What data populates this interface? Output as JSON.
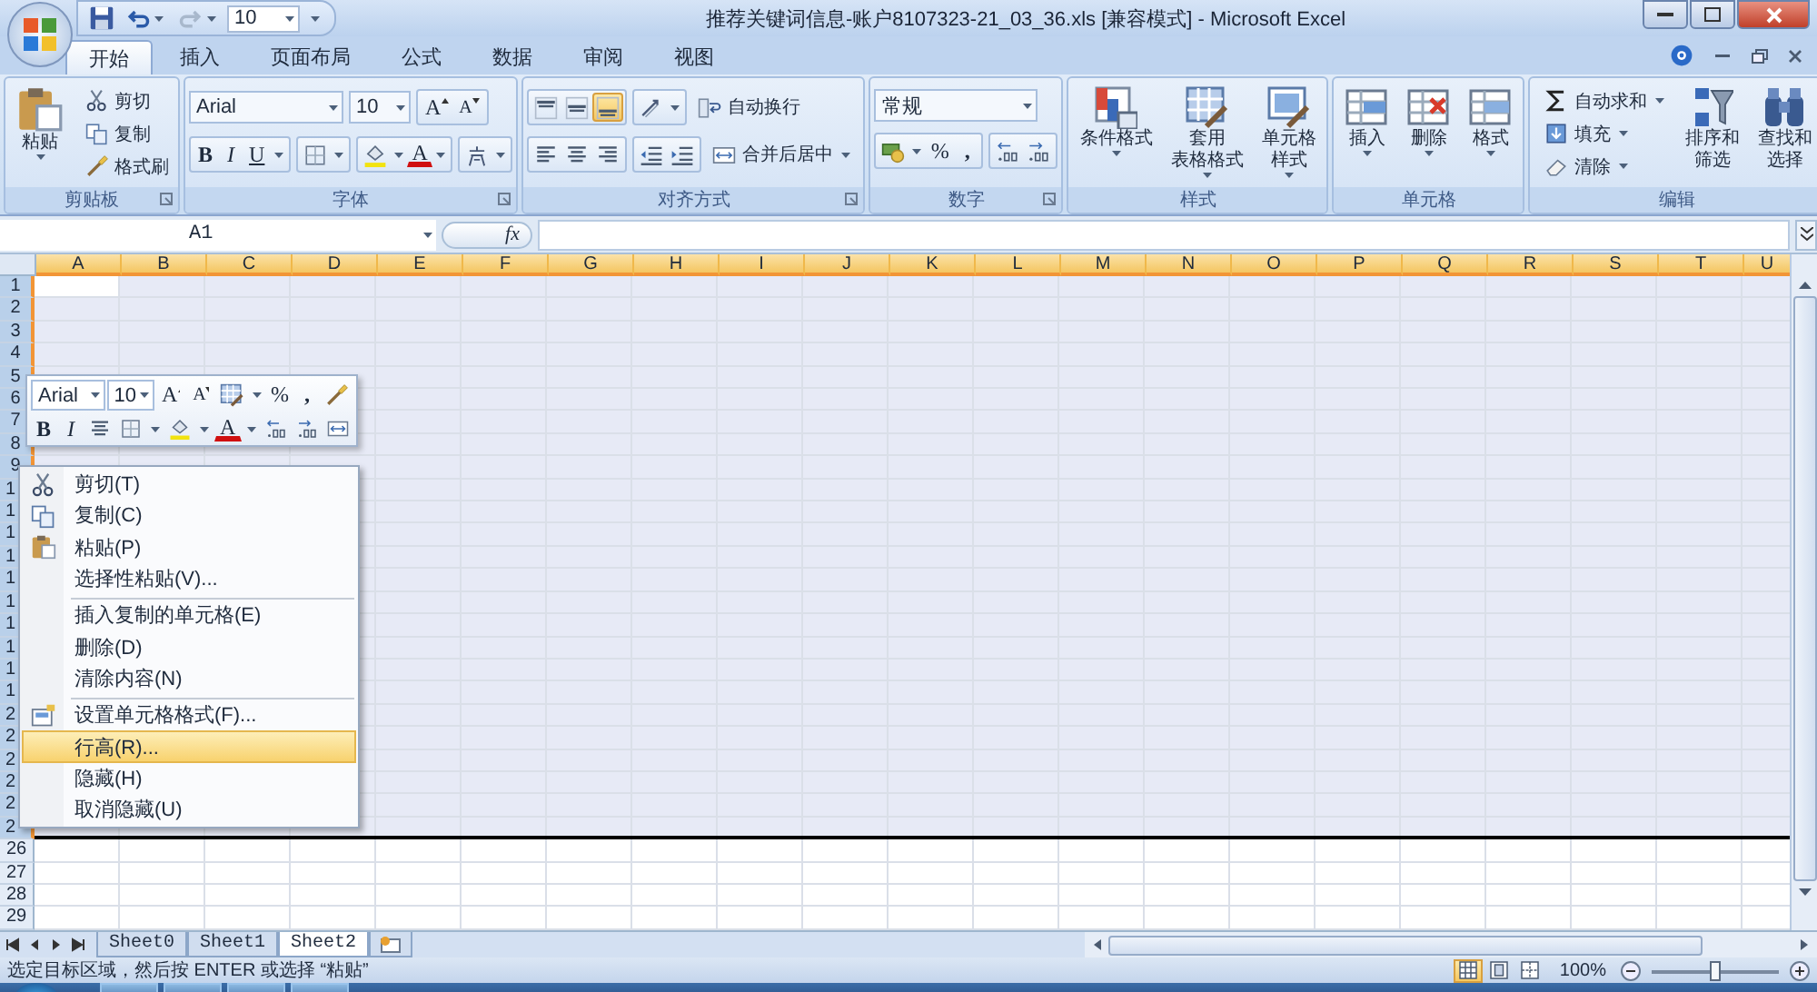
{
  "title_bar": {
    "font_size": "10",
    "title": "推荐关键词信息-账户8107323-21_03_36.xls  [兼容模式] - Microsoft Excel"
  },
  "tabs": [
    {
      "label": "开始",
      "selected": true
    },
    {
      "label": "插入",
      "selected": false
    },
    {
      "label": "页面布局",
      "selected": false
    },
    {
      "label": "公式",
      "selected": false
    },
    {
      "label": "数据",
      "selected": false
    },
    {
      "label": "审阅",
      "selected": false
    },
    {
      "label": "视图",
      "selected": false
    }
  ],
  "ribbon": {
    "clipboard": {
      "label": "剪贴板",
      "launcher": true,
      "paste": "粘贴",
      "items": [
        {
          "kind": "cut",
          "label": "剪切"
        },
        {
          "kind": "copy",
          "label": "复制"
        },
        {
          "kind": "brush",
          "label": "格式刷"
        }
      ]
    },
    "font": {
      "label": "字体",
      "launcher": true,
      "font_name": "Arial",
      "font_size": "10",
      "grow": "A",
      "shrink": "A",
      "bold": "B",
      "italic": "I",
      "underline": "U",
      "font_color": "A"
    },
    "alignment": {
      "label": "对齐方式",
      "launcher": true,
      "vertical": [
        {
          "selected": false
        },
        {
          "selected": false
        },
        {
          "selected": true
        }
      ],
      "horizontal": [
        {
          "selected": false
        },
        {
          "selected": false
        },
        {
          "selected": false
        }
      ],
      "wrap": "自动换行",
      "merge": "合并后居中"
    },
    "number": {
      "label": "数字",
      "launcher": true,
      "format": "常规",
      "percent": "%",
      "comma": ","
    },
    "styles": {
      "label": "样式",
      "buttons": [
        {
          "kind": "cond",
          "lines": [
            "条件格式"
          ]
        },
        {
          "kind": "table",
          "lines": [
            "套用",
            "表格格式"
          ]
        },
        {
          "kind": "cellstyle",
          "lines": [
            "单元格",
            "样式"
          ]
        }
      ]
    },
    "cells": {
      "label": "单元格",
      "buttons": [
        {
          "kind": "insert",
          "label": "插入"
        },
        {
          "kind": "delete",
          "label": "删除"
        },
        {
          "kind": "format",
          "label": "格式"
        }
      ]
    },
    "editing": {
      "label": "编辑",
      "small": [
        {
          "kind": "sum",
          "label": "自动求和"
        },
        {
          "kind": "filldown",
          "label": "填充"
        },
        {
          "kind": "eraser",
          "label": "清除"
        }
      ],
      "big": [
        {
          "kind": "sort",
          "lines": [
            "排序和",
            "筛选"
          ]
        },
        {
          "kind": "find",
          "lines": [
            "查找和",
            "选择"
          ]
        }
      ]
    }
  },
  "formula_bar": {
    "name_box": "A1",
    "function_button": "fx"
  },
  "columns": [
    {
      "label": "A",
      "selected": true
    },
    {
      "label": "B",
      "selected": true
    },
    {
      "label": "C",
      "selected": true
    },
    {
      "label": "D",
      "selected": true
    },
    {
      "label": "E",
      "selected": true
    },
    {
      "label": "F",
      "selected": true
    },
    {
      "label": "G",
      "selected": true
    },
    {
      "label": "H",
      "selected": true
    },
    {
      "label": "I",
      "selected": true
    },
    {
      "label": "J",
      "selected": true
    },
    {
      "label": "K",
      "selected": true
    },
    {
      "label": "L",
      "selected": true
    },
    {
      "label": "M",
      "selected": true
    },
    {
      "label": "N",
      "selected": true
    },
    {
      "label": "O",
      "selected": true
    },
    {
      "label": "P",
      "selected": true
    },
    {
      "label": "Q",
      "selected": true
    },
    {
      "label": "R",
      "selected": true
    },
    {
      "label": "S",
      "selected": true
    },
    {
      "label": "T",
      "selected": true
    },
    {
      "label": "U",
      "selected": true
    }
  ],
  "rows": [
    {
      "label": "1",
      "selected": true,
      "active": true
    },
    {
      "label": "2",
      "selected": true,
      "active": false
    },
    {
      "label": "3",
      "selected": true,
      "active": false
    },
    {
      "label": "4",
      "selected": true,
      "active": false
    },
    {
      "label": "5",
      "selected": true,
      "active": false
    },
    {
      "label": "6",
      "selected": true,
      "active": false
    },
    {
      "label": "7",
      "selected": true,
      "active": false
    },
    {
      "label": "8",
      "selected": true,
      "active": false
    },
    {
      "label": "9",
      "selected": true,
      "active": false
    },
    {
      "label": "1",
      "selected": true,
      "active": false
    },
    {
      "label": "1",
      "selected": true,
      "active": false
    },
    {
      "label": "1",
      "selected": true,
      "active": false
    },
    {
      "label": "1",
      "selected": true,
      "active": false
    },
    {
      "label": "1",
      "selected": true,
      "active": false
    },
    {
      "label": "1",
      "selected": true,
      "active": false
    },
    {
      "label": "1",
      "selected": true,
      "active": false
    },
    {
      "label": "1",
      "selected": true,
      "active": false
    },
    {
      "label": "1",
      "selected": true,
      "active": false
    },
    {
      "label": "1",
      "selected": true,
      "active": false
    },
    {
      "label": "2",
      "selected": true,
      "active": false
    },
    {
      "label": "2",
      "selected": true,
      "active": false
    },
    {
      "label": "2",
      "selected": true,
      "active": false
    },
    {
      "label": "2",
      "selected": true,
      "active": false
    },
    {
      "label": "2",
      "selected": true,
      "active": false
    },
    {
      "label": "2",
      "selected": true,
      "active": false
    },
    {
      "label": "26",
      "selected": false
    },
    {
      "label": "27",
      "selected": false
    },
    {
      "label": "28",
      "selected": false
    },
    {
      "label": "29",
      "selected": false
    }
  ],
  "mini_toolbar": {
    "font_name": "Arial",
    "font_size": "10",
    "grow": "A",
    "shrink": "A",
    "percent": "%",
    "comma": ",",
    "bold": "B",
    "italic": "I",
    "font_color": "A"
  },
  "context_menu": [
    {
      "label": "剪切(T)",
      "kind": "cut",
      "separator_before": false,
      "selected": false
    },
    {
      "label": "复制(C)",
      "kind": "copy",
      "separator_before": false,
      "selected": false
    },
    {
      "label": "粘贴(P)",
      "kind": "paste",
      "separator_before": false,
      "selected": false
    },
    {
      "label": "选择性粘贴(V)...",
      "separator_before": false,
      "selected": false
    },
    {
      "label": "插入复制的单元格(E)",
      "separator_before": true,
      "selected": false
    },
    {
      "label": "删除(D)",
      "separator_before": false,
      "selected": false
    },
    {
      "label": "清除内容(N)",
      "separator_before": false,
      "selected": false
    },
    {
      "label": "设置单元格格式(F)...",
      "kind": "cellfmt",
      "separator_before": true,
      "selected": false
    },
    {
      "label": "行高(R)...",
      "separator_before": false,
      "selected": true
    },
    {
      "label": "隐藏(H)",
      "separator_before": false,
      "selected": false
    },
    {
      "label": "取消隐藏(U)",
      "separator_before": false,
      "selected": false
    }
  ],
  "sheet_tabs": [
    {
      "label": "Sheet0",
      "selected": false
    },
    {
      "label": "Sheet1",
      "selected": false
    },
    {
      "label": "Sheet2",
      "selected": true
    }
  ],
  "status_bar": {
    "message": "选定目标区域，然后按 ENTER 或选择 “粘贴”",
    "views": [
      {
        "kind": "normal",
        "selected": true
      },
      {
        "kind": "layout",
        "selected": false
      },
      {
        "kind": "pagebreak",
        "selected": false
      }
    ],
    "zoom": "100%",
    "zoom_slider": {
      "level": 0.5
    }
  }
}
